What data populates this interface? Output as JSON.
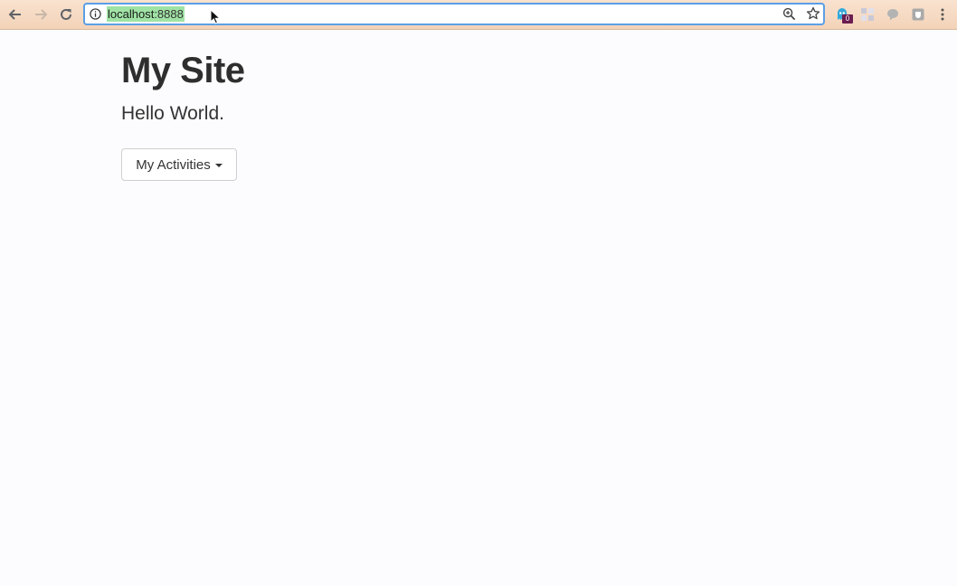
{
  "browser": {
    "url_host": "localhost",
    "url_port": ":8888",
    "extension_badge_count": "0",
    "icons": {
      "back": "arrow-left-icon",
      "forward": "arrow-right-icon",
      "reload": "reload-icon",
      "site_info": "info-icon",
      "zoom": "zoom-icon",
      "bookmark": "star-icon",
      "menu": "kebab-menu-icon"
    }
  },
  "page": {
    "title": "My Site",
    "lead": "Hello World.",
    "dropdown_label": "My Activities"
  },
  "colors": {
    "toolbar": "#f3d3b8",
    "url_highlight": "#9fe3a4",
    "focus_ring": "#5b9fe6",
    "page_bg": "#fcfcfe",
    "text": "#333333"
  }
}
